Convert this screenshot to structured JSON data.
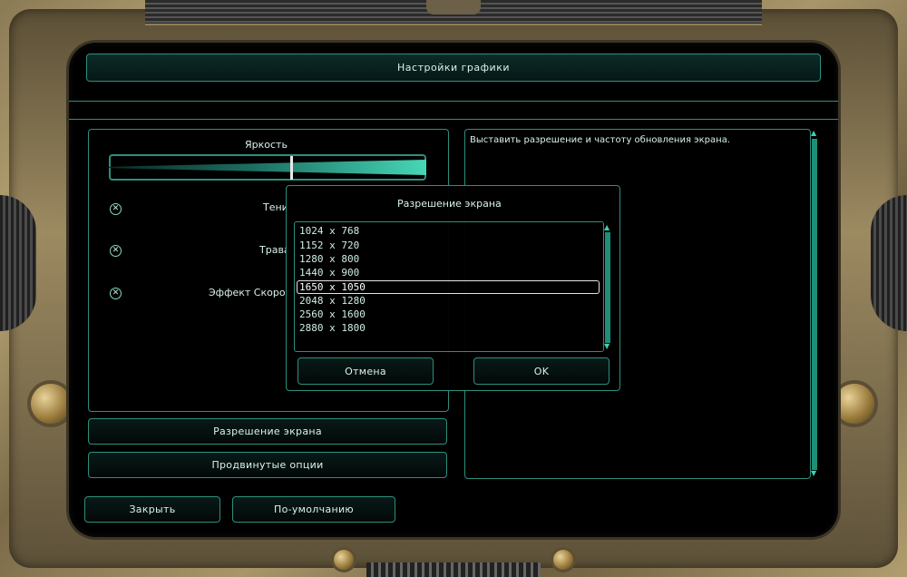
{
  "window": {
    "title": "Настройки графики"
  },
  "left_panel": {
    "brightness_label": "Яркость",
    "brightness_level": 0.57,
    "options": [
      {
        "label": "Тени",
        "checked": true
      },
      {
        "label": "Трава",
        "checked": true
      },
      {
        "label": "Эффект Скорости",
        "checked": true
      }
    ],
    "check_glyph": "✕"
  },
  "description": {
    "text": "Выставить разрешение и частоту обновления экрана."
  },
  "buttons": {
    "screen_resolution": "Разрешение экрана",
    "advanced_options": "Продвинутые опции",
    "close": "Закрыть",
    "defaults": "По-умолчанию"
  },
  "popup": {
    "title": "Разрешение экрана",
    "resolutions": [
      "1024 x 768",
      "1152 x 720",
      "1280 x 800",
      "1440 x 900",
      "1650 x 1050",
      "2048 x 1280",
      "2560 x 1600",
      "2880 x 1800"
    ],
    "selected_resolution": "1650 x 1050",
    "cancel_label": "Отмена",
    "ok_label": "OK"
  },
  "icons": {
    "scroll_up": "up-arrow-icon",
    "scroll_down": "down-arrow-icon",
    "checkbox": "cross-icon"
  },
  "colors": {
    "accent": "#2d8f7e",
    "accent_bright": "#46d7b6",
    "frame": "#a8956a"
  }
}
